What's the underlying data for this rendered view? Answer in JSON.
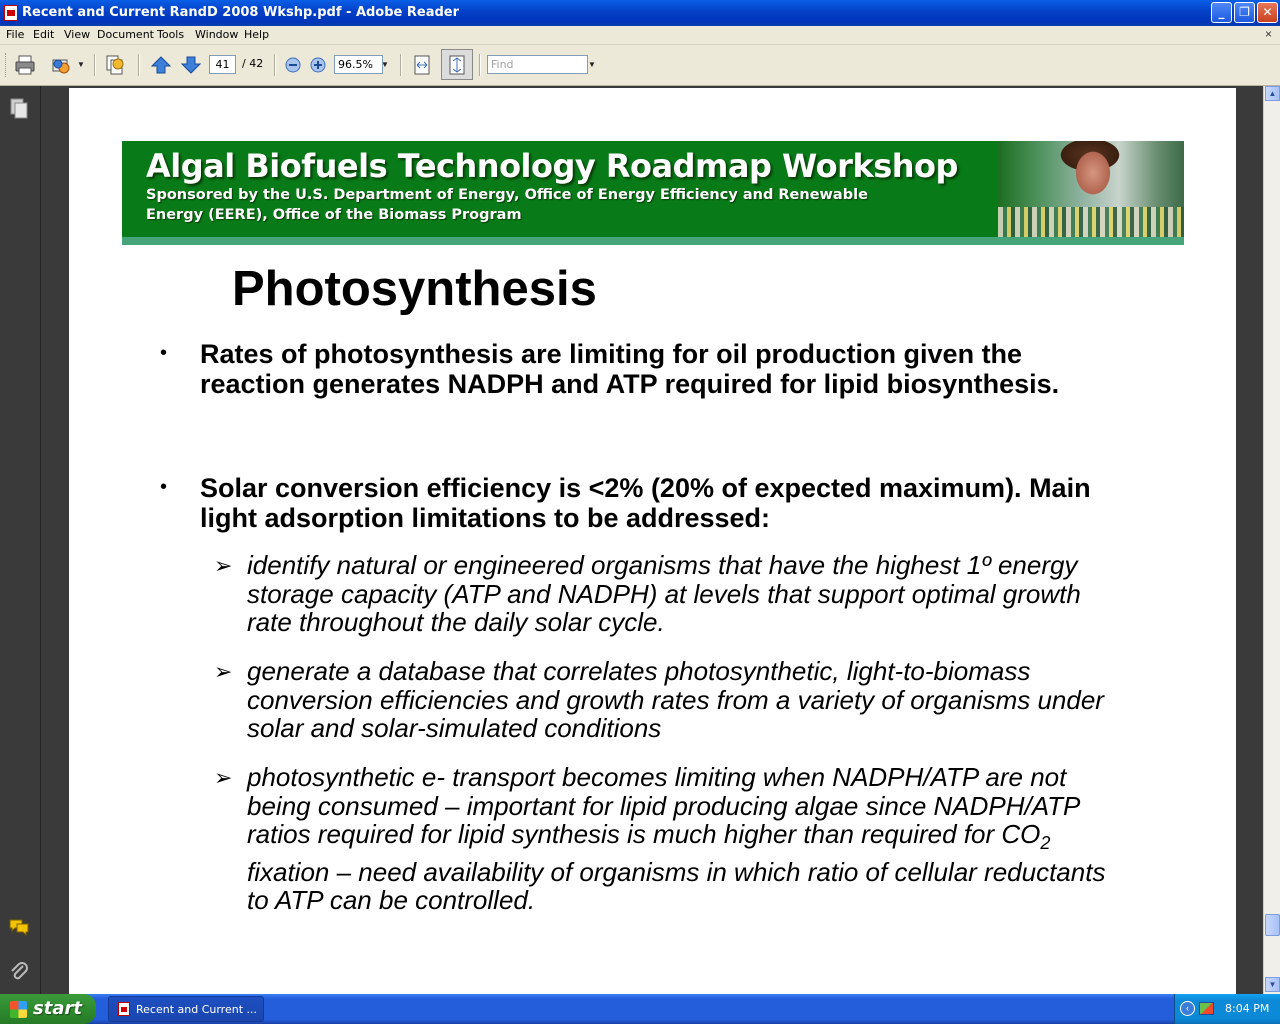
{
  "window": {
    "title": "Recent and Current RandD 2008 Wkshp.pdf - Adobe Reader",
    "minimize": "_",
    "maximize": "❐",
    "close": "✕"
  },
  "menu": {
    "items": [
      "File",
      "Edit",
      "View",
      "Document",
      "Tools",
      "Window",
      "Help"
    ],
    "close_glyph": "×"
  },
  "toolbar": {
    "page_current": "41",
    "page_total": "/ 42",
    "zoom": "96.5%",
    "find_placeholder": "Find"
  },
  "slide": {
    "banner_title": "Algal Biofuels Technology Roadmap Workshop",
    "banner_sub1": "Sponsored by the U.S. Department of Energy, Office of Energy Efficiency and Renewable",
    "banner_sub2": "Energy (EERE),  Office of the Biomass Program",
    "title": "Photosynthesis",
    "bullets": [
      "Rates of photosynthesis are limiting for oil production given the reaction generates NADPH and ATP required for lipid biosynthesis.",
      "Solar conversion efficiency is <2% (20% of expected maximum). Main light adsorption limitations to be addressed:"
    ],
    "sub_bullets": [
      " identify natural or engineered organisms that have the highest 1º energy storage capacity (ATP and NADPH) at levels that support optimal growth rate throughout the daily solar cycle.",
      " generate a database that correlates photosynthetic, light-to-biomass conversion efficiencies and growth rates from a variety of organisms under solar and solar-simulated conditions"
    ],
    "sub3_part1": " photosynthetic e- transport becomes limiting when NADPH/ATP are not being consumed – important for lipid producing algae since NADPH/ATP ratios required for lipid synthesis is much higher than required for CO",
    "sub3_subscript": "2",
    "sub3_part2": " fixation – need availability of organisms in which ratio of cellular reductants to ATP can be controlled."
  },
  "taskbar": {
    "start_label": "start",
    "task_label": "Recent and Current ...",
    "clock": "8:04 PM"
  }
}
